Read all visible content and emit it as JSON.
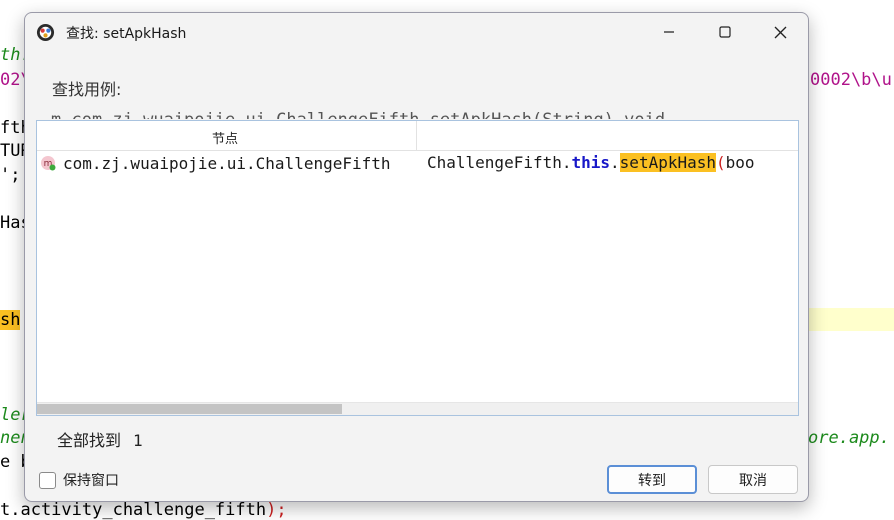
{
  "background_editor": {
    "lines": [
      {
        "text": "th.",
        "style": "green"
      },
      {
        "text": "02\\",
        "style": "pink"
      },
      {
        "text": "0002\\b\\u",
        "style": "pink"
      },
      {
        "text": "fth",
        "style": "plain"
      },
      {
        "text": "TUR",
        "style": "plain"
      },
      {
        "text": "';",
        "style": "plain"
      },
      {
        "text": "Has",
        "style": "plain"
      },
      {
        "text": "sh",
        "style": "hl"
      },
      {
        "text": "(",
        "style": "red"
      },
      {
        "text": "ler",
        "style": "green"
      },
      {
        "text": "nen",
        "style": "green"
      },
      {
        "text": "ore.app.",
        "style": "green"
      },
      {
        "text": "e b",
        "style": "plain"
      },
      {
        "text": "t.activity_challenge_fifth",
        "style": "plain"
      },
      {
        "text": ");",
        "style": "red"
      }
    ]
  },
  "dialog": {
    "title": "查找: setApkHash",
    "find_usages_label": "查找用例:",
    "ghost_text": "m com.zj.wuaipojie.ui.ChallengeFifth.setApkHash(String) void",
    "column_node": "节点",
    "column_code": "",
    "results": [
      {
        "node": "com.zj.wuaipojie.ui.ChallengeFifth",
        "icon": "method-icon",
        "code_prefix": "ChallengeFifth.",
        "code_keyword": "this",
        "code_dot": ".",
        "code_match": "setApkHash",
        "code_paren": "(",
        "code_suffix": "boo"
      }
    ],
    "found_label": "全部找到",
    "found_count": "1",
    "keep_window_label": "保持窗口",
    "keep_window_checked": false,
    "goto_button": "转到",
    "cancel_button": "取消"
  },
  "colors": {
    "highlight": "#fbc022",
    "keyword": "#1818c8",
    "accent_border": "#5b8fd6"
  }
}
